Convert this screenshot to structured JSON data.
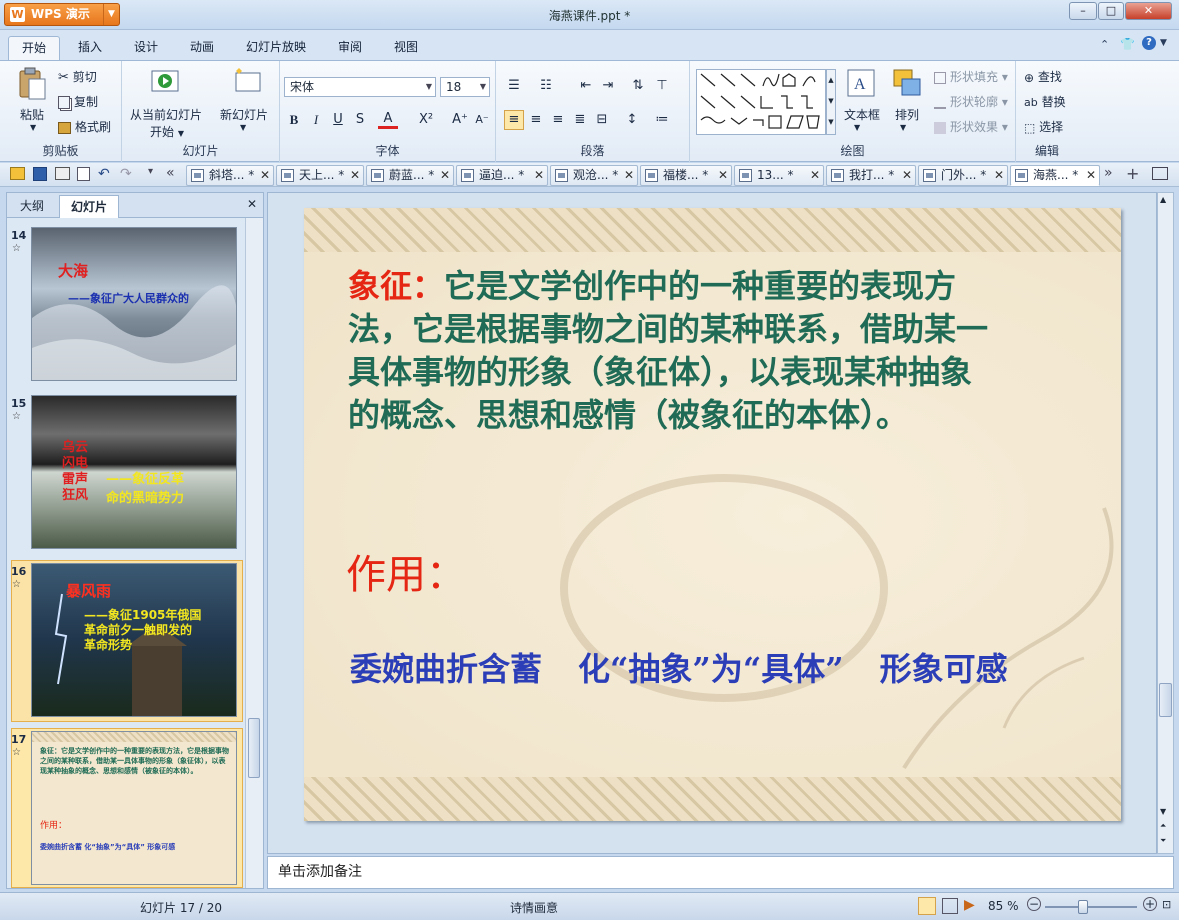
{
  "app": {
    "name": "WPS 演示",
    "title": "海燕课件.ppt *"
  },
  "ribbon_tabs": [
    "开始",
    "插入",
    "设计",
    "动画",
    "幻灯片放映",
    "审阅",
    "视图"
  ],
  "clipboard": {
    "paste": "粘贴",
    "cut": "剪切",
    "copy": "复制",
    "format_painter": "格式刷",
    "label": "剪贴板"
  },
  "slides_group": {
    "from_current_1": "从当前幻灯片",
    "from_current_2": "开始",
    "new_slide": "新幻灯片",
    "label": "幻灯片"
  },
  "font": {
    "name": "宋体",
    "size": "18",
    "label": "字体",
    "bold": "B",
    "italic": "I",
    "underline": "U",
    "shadow": "S"
  },
  "paragraph": {
    "label": "段落"
  },
  "drawing": {
    "textbox": "文本框",
    "arrange": "排列",
    "fill": "形状填充",
    "outline": "形状轮廓",
    "effects": "形状效果",
    "label": "绘图"
  },
  "editing": {
    "find": "查找",
    "replace": "替换",
    "select": "选择",
    "label": "编辑"
  },
  "doc_tabs": [
    {
      "label": "斜塔... *"
    },
    {
      "label": "天上... *"
    },
    {
      "label": "蔚蓝... *"
    },
    {
      "label": "逼迫... *"
    },
    {
      "label": "观沧... *"
    },
    {
      "label": "福楼... *"
    },
    {
      "label": "13... *"
    },
    {
      "label": "我打... *"
    },
    {
      "label": "门外... *"
    },
    {
      "label": "海燕... *"
    }
  ],
  "left_pane": {
    "tab_outline": "大纲",
    "tab_slides": "幻灯片"
  },
  "thumbnails": {
    "s14": {
      "num": "14",
      "t1": "大海",
      "t2": "——象征广大人民群众的"
    },
    "s15": {
      "num": "15",
      "t1": "乌云",
      "t2": "闪电",
      "t3": "雷声",
      "t4": "狂风",
      "t5": "——象征反革",
      "t6": "命的黑暗势力"
    },
    "s16": {
      "num": "16",
      "t1": "暴风雨",
      "t2": "——象征1905年俄国",
      "t3": "革命前夕一触即发的",
      "t4": "革命形势"
    },
    "s17": {
      "num": "17",
      "t1": "象征：它是文学创作中的一种重要的表现方法，它是根据事物之间的某种联系，借助某一具体事物的形象（象征体），以表现某种抽象的概念、思想和感情（被象征的本体）。",
      "t2": "作用：",
      "t3": "委婉曲折含蓄  化“抽象”为“具体”  形象可感"
    }
  },
  "slide": {
    "term": "象征：",
    "line1": "它是文学创作中的一种重要的表现方",
    "line2": "法，它是根据事物之间的某种联系，借助某一",
    "line3": "具体事物的形象（象征体），以表现某种抽象",
    "line4": "的概念、思想和感情（被象征的本体）。",
    "role_label": "作用：",
    "effect1": "委婉曲折含蓄",
    "effect2": "化“抽象”为“具体”",
    "effect3": "形象可感"
  },
  "notes_placeholder": "单击添加备注",
  "status": {
    "slides": "幻灯片 17 / 20",
    "theme": "诗情画意",
    "zoom": "85 %"
  },
  "colors": {
    "accent_orange": "#e7761c",
    "slide_red": "#e52613",
    "slide_green": "#1f6b55",
    "slide_blue": "#2b3eb8"
  }
}
